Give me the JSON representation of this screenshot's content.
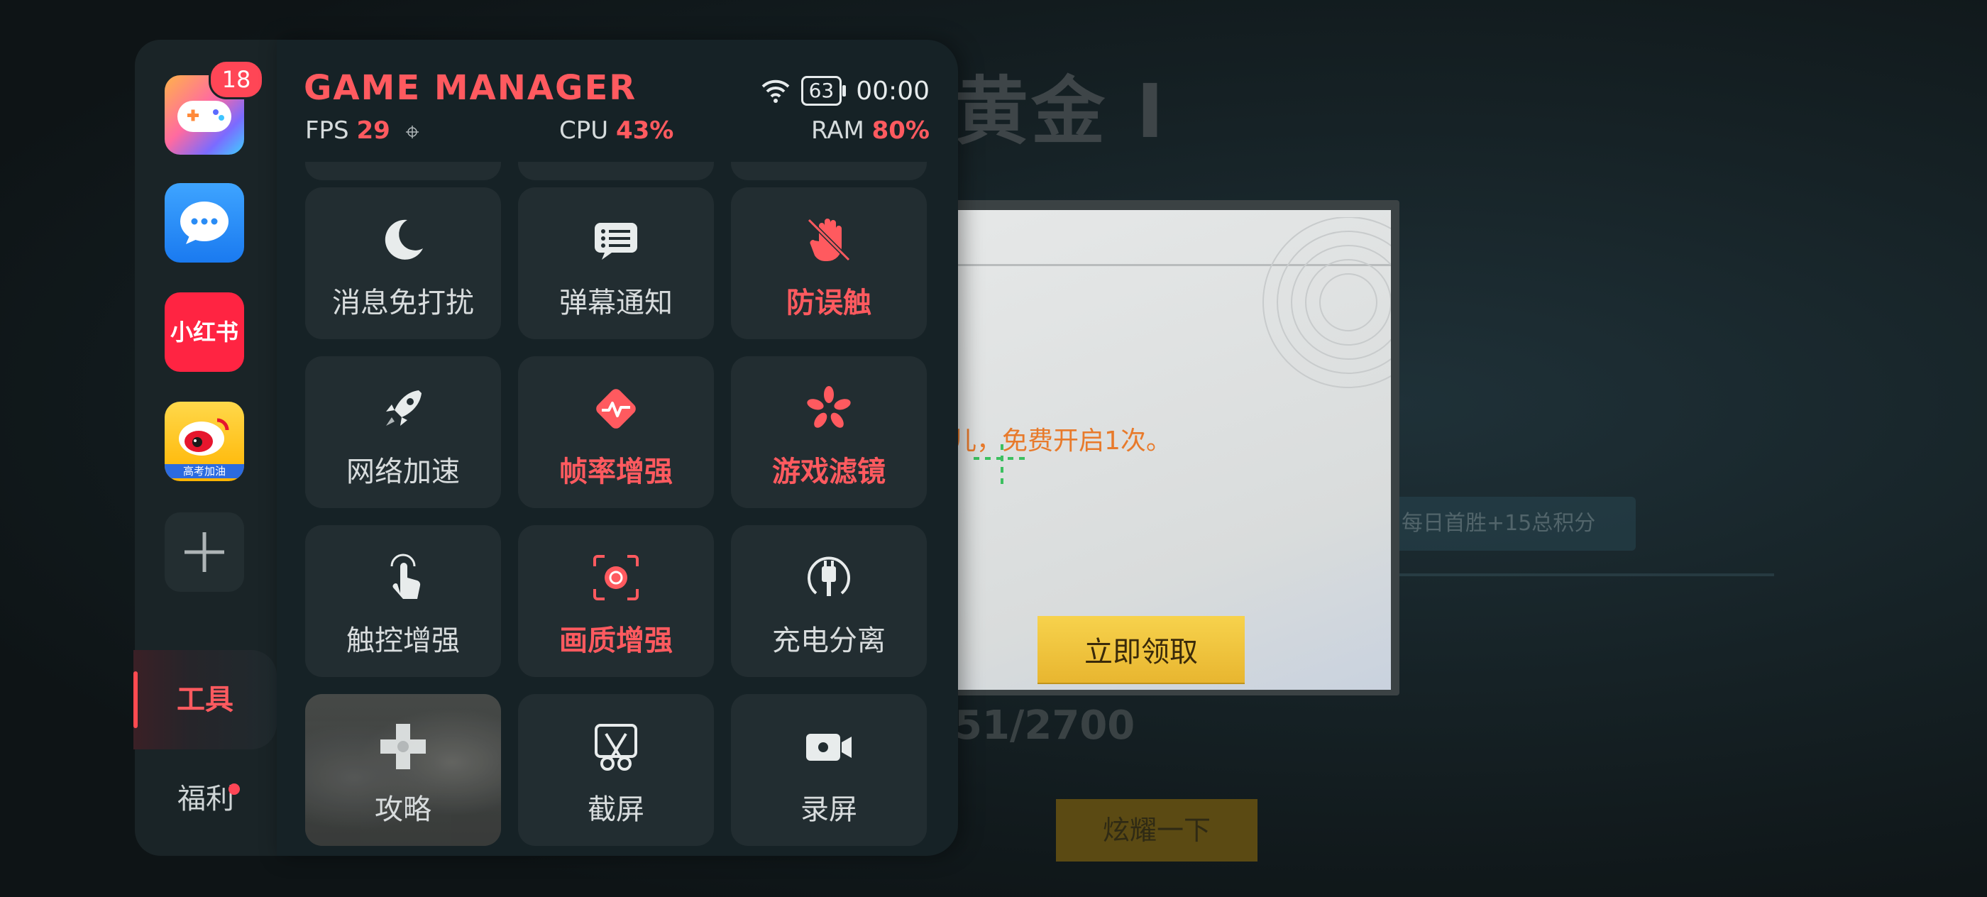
{
  "game_bg": {
    "rank": "黄金 Ⅰ",
    "popup_text": "儿，免费开启1次。",
    "claim_button": "立即领取",
    "streak_text": "每日首胜+15总积分",
    "score": "51/2700",
    "show_off_button": "炫耀一下"
  },
  "sidebar": {
    "game_center_badge": "18",
    "xiaohongshu_label": "小红书",
    "weibo_label": "高考加油",
    "nav_tools": "工具",
    "nav_welfare": "福利"
  },
  "header": {
    "title": "GAME MANAGER",
    "battery": "63",
    "time": "00:00"
  },
  "stats": {
    "fps_label": "FPS",
    "fps_value": "29",
    "cpu_label": "CPU",
    "cpu_value": "43%",
    "ram_label": "RAM",
    "ram_value": "80%"
  },
  "tiles": {
    "dnd": "消息免打扰",
    "barrage": "弹幕通知",
    "anti_touch": "防误触",
    "network": "网络加速",
    "framerate": "帧率增强",
    "filter": "游戏滤镜",
    "touch": "触控增强",
    "image_quality": "画质增强",
    "charging": "充电分离",
    "guide": "攻略",
    "screenshot": "截屏",
    "record": "录屏"
  },
  "colors": {
    "accent": "#ff5a5f",
    "panel_bg": "#162226",
    "tile_bg": "#222d31"
  }
}
